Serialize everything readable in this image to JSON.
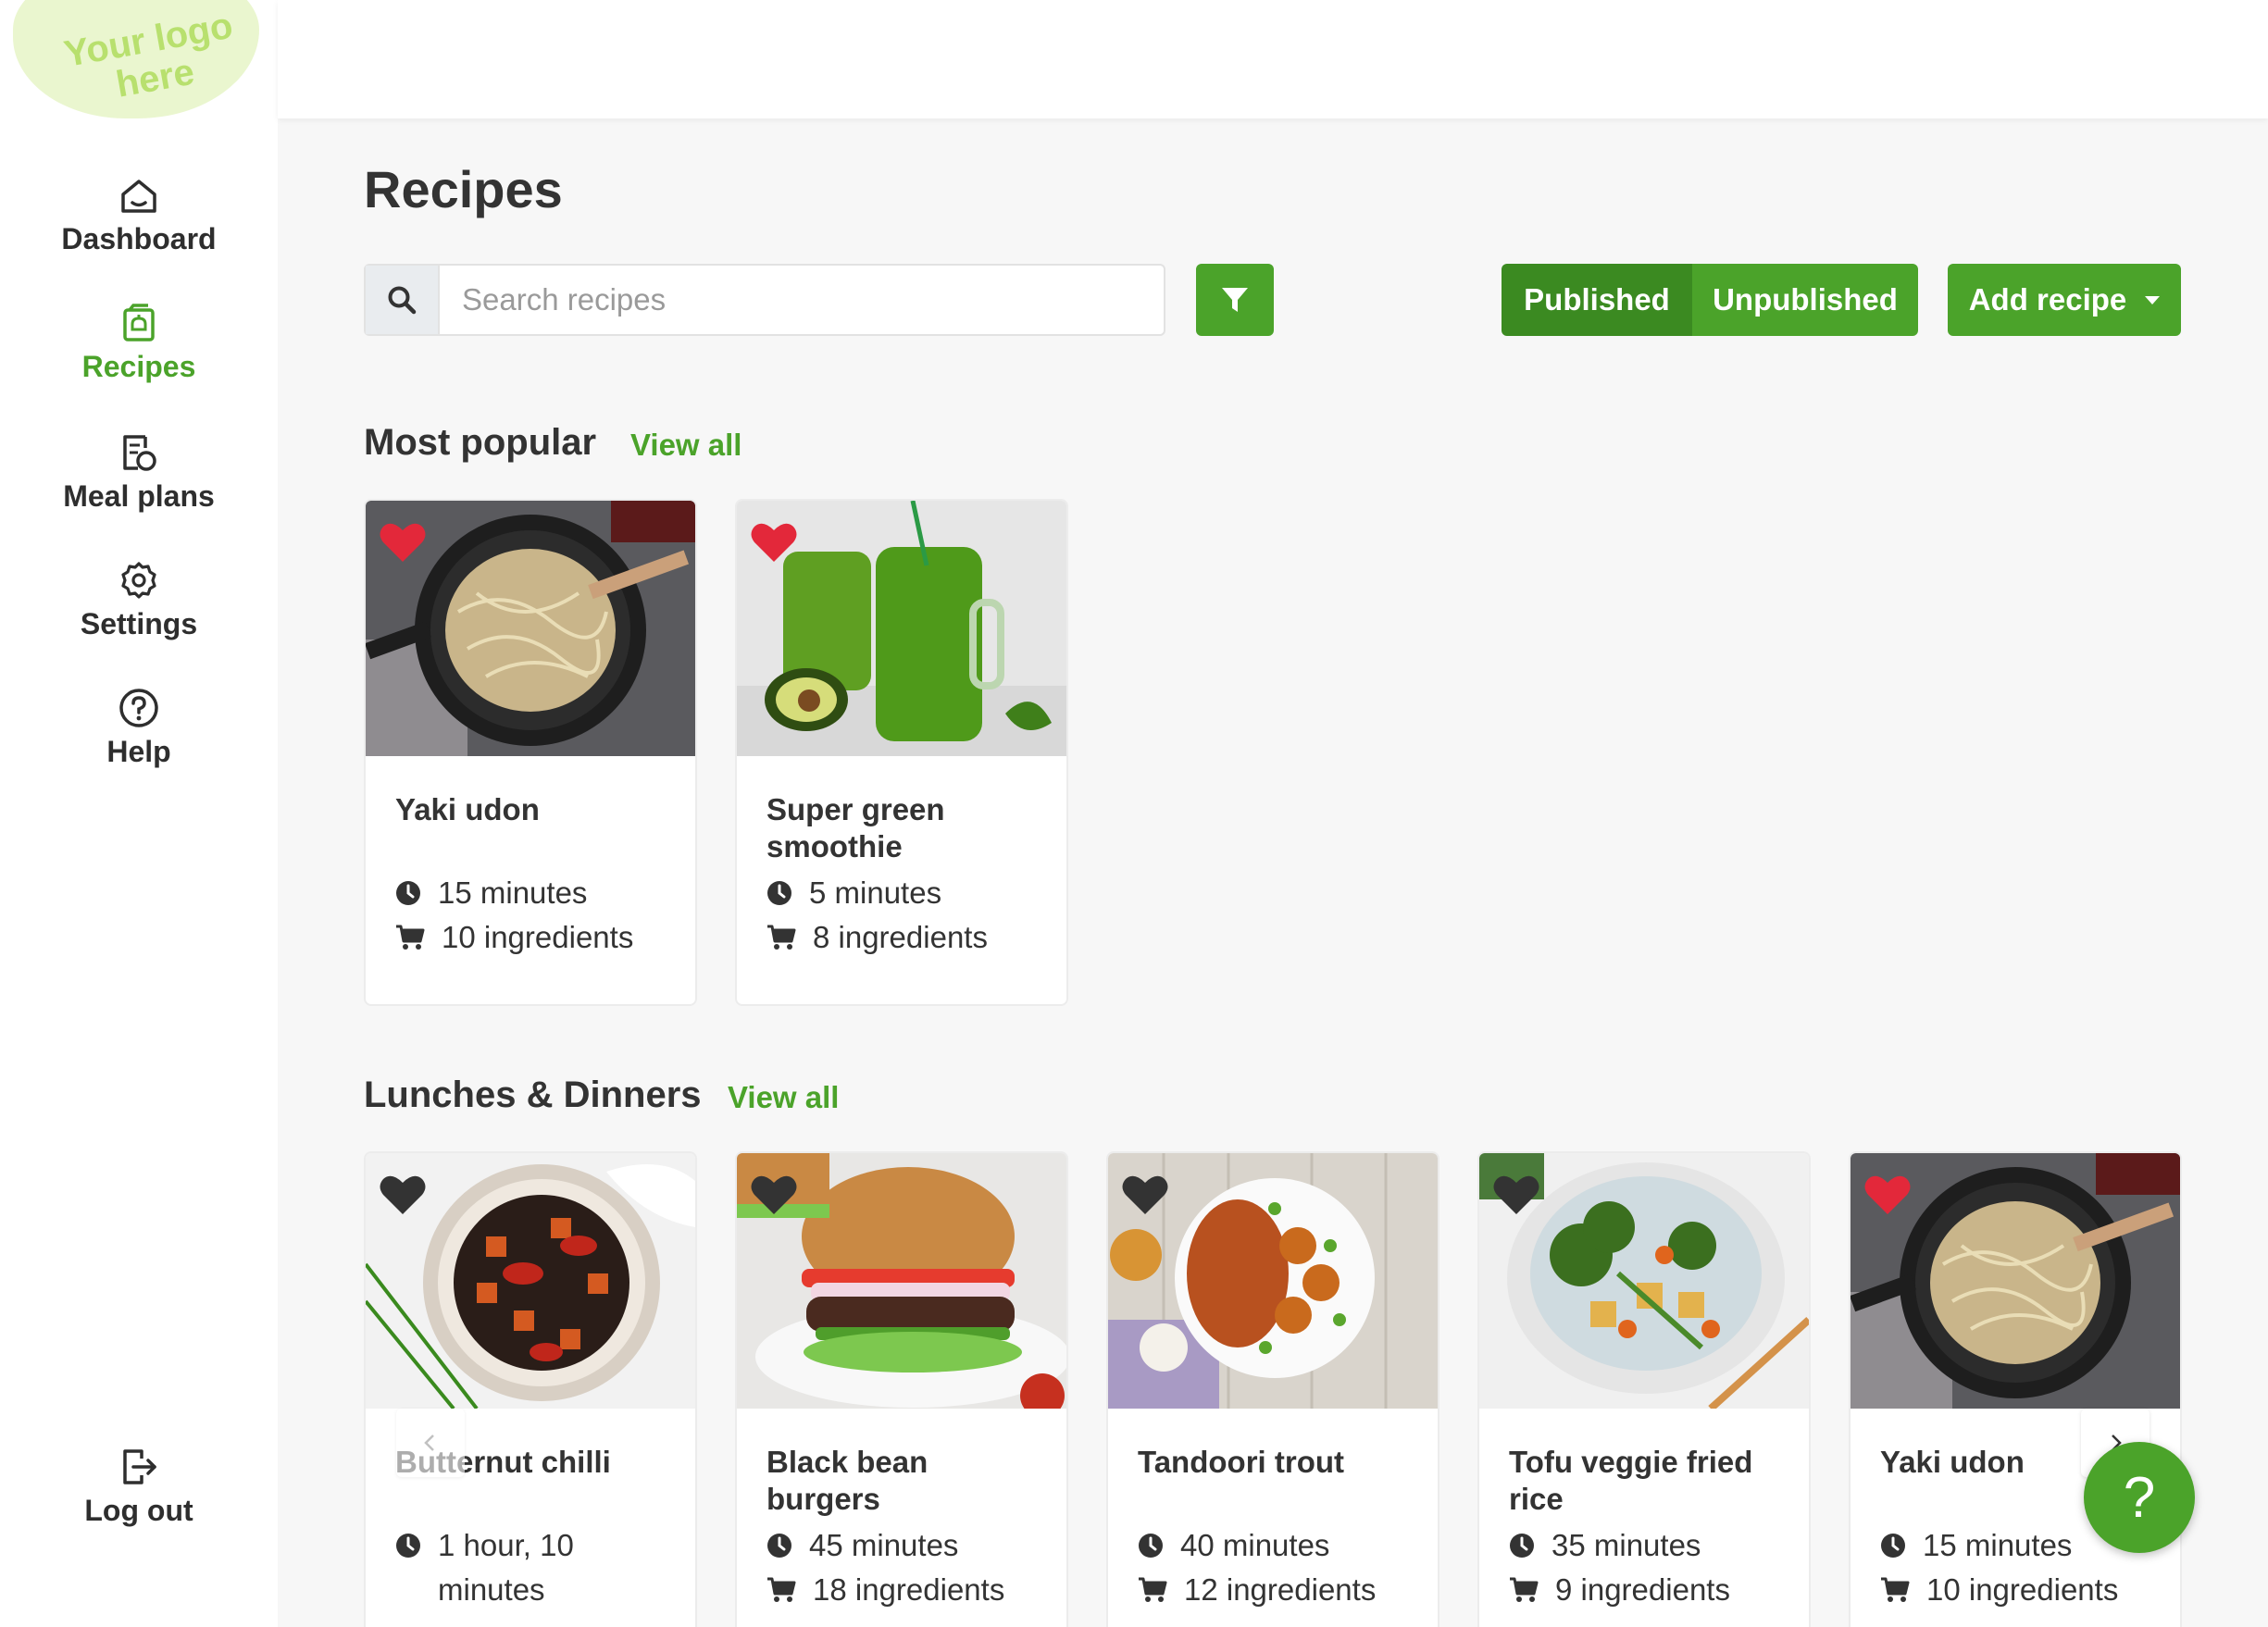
{
  "logo": {
    "text": "Your logo here"
  },
  "sidebar": {
    "items": [
      {
        "label": "Dashboard",
        "icon": "home-icon"
      },
      {
        "label": "Recipes",
        "icon": "recipe-book-icon",
        "active": true
      },
      {
        "label": "Meal plans",
        "icon": "meal-plan-icon"
      },
      {
        "label": "Settings",
        "icon": "gear-icon"
      },
      {
        "label": "Help",
        "icon": "question-circle-icon"
      }
    ],
    "logout": {
      "label": "Log out",
      "icon": "logout-icon"
    }
  },
  "main": {
    "title": "Recipes",
    "search": {
      "placeholder": "Search recipes",
      "value": ""
    },
    "filter": {
      "icon": "filter-icon"
    },
    "toggle": {
      "published": "Published",
      "unpublished": "Unpublished",
      "selected": "Published"
    },
    "add_recipe": "Add recipe"
  },
  "sections": [
    {
      "title": "Most popular",
      "view_all": "View all",
      "recipes": [
        {
          "title": "Yaki udon",
          "time": "15 minutes",
          "ingredients": "10 ingredients",
          "favorite": true
        },
        {
          "title": "Super green smoothie",
          "time": "5 minutes",
          "ingredients": "8 ingredients",
          "favorite": true
        }
      ]
    },
    {
      "title": "Lunches & Dinners",
      "view_all": "View all",
      "recipes": [
        {
          "title": "Butternut chilli",
          "time": "1 hour, 10 minutes",
          "ingredients": "",
          "favorite": false
        },
        {
          "title": "Black bean burgers",
          "time": "45 minutes",
          "ingredients": "18 ingredients",
          "favorite": false
        },
        {
          "title": "Tandoori trout",
          "time": "40 minutes",
          "ingredients": "12 ingredients",
          "favorite": false
        },
        {
          "title": "Tofu veggie fried rice",
          "time": "35 minutes",
          "ingredients": "9 ingredients",
          "favorite": false
        },
        {
          "title": "Yaki udon",
          "time": "15 minutes",
          "ingredients": "10 ingredients",
          "favorite": true
        }
      ]
    }
  ],
  "help_fab": "?",
  "colors": {
    "accent": "#4ba32a",
    "accent_dark": "#3b8a21",
    "favorite": "#e3283a",
    "not_favorite": "#333333",
    "logo_bg": "#eaf6cf"
  }
}
